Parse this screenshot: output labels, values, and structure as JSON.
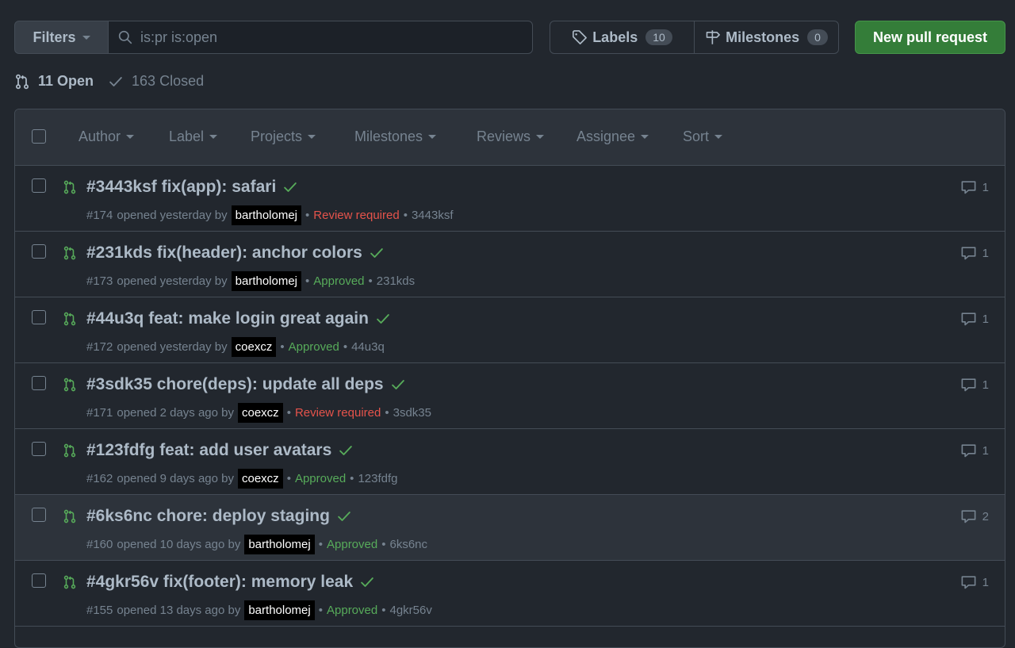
{
  "toolbar": {
    "filters_label": "Filters",
    "search_value": "is:pr is:open",
    "labels_label": "Labels",
    "labels_count": "10",
    "milestones_label": "Milestones",
    "milestones_count": "0",
    "new_pr_label": "New pull request"
  },
  "states": {
    "open_label": "11 Open",
    "closed_label": "163 Closed"
  },
  "header_filters": [
    {
      "label": "Author"
    },
    {
      "label": "Label"
    },
    {
      "label": "Projects"
    },
    {
      "label": "Milestones"
    },
    {
      "label": "Reviews"
    },
    {
      "label": "Assignee"
    },
    {
      "label": "Sort"
    }
  ],
  "pull_requests": [
    {
      "title": "#3443ksf fix(app): safari",
      "number": "#174",
      "opened": "opened yesterday by",
      "author": "bartholomej",
      "review": "Review required",
      "review_state": "required",
      "ref": "3443ksf",
      "comments": "1"
    },
    {
      "title": "#231kds fix(header): anchor colors",
      "number": "#173",
      "opened": "opened yesterday by",
      "author": "bartholomej",
      "review": "Approved",
      "review_state": "approved",
      "ref": "231kds",
      "comments": "1"
    },
    {
      "title": "#44u3q feat: make login great again",
      "number": "#172",
      "opened": "opened yesterday by",
      "author": "coexcz",
      "review": "Approved",
      "review_state": "approved",
      "ref": "44u3q",
      "comments": "1"
    },
    {
      "title": "#3sdk35 chore(deps): update all deps",
      "number": "#171",
      "opened": "opened 2 days ago by",
      "author": "coexcz",
      "review": "Review required",
      "review_state": "required",
      "ref": "3sdk35",
      "comments": "1"
    },
    {
      "title": "#123fdfg feat: add user avatars",
      "number": "#162",
      "opened": "opened 9 days ago by",
      "author": "coexcz",
      "review": "Approved",
      "review_state": "approved",
      "ref": "123fdfg",
      "comments": "1"
    },
    {
      "title": "#6ks6nc chore: deploy staging",
      "number": "#160",
      "opened": "opened 10 days ago by",
      "author": "bartholomej",
      "review": "Approved",
      "review_state": "approved",
      "ref": "6ks6nc",
      "comments": "2"
    },
    {
      "title": "#4gkr56v fix(footer): memory leak",
      "number": "#155",
      "opened": "opened 13 days ago by",
      "author": "bartholomej",
      "review": "Approved",
      "review_state": "approved",
      "ref": "4gkr56v",
      "comments": "1"
    }
  ],
  "colors": {
    "background": "#22272e",
    "accent_green": "#347d39",
    "approved": "#57ab5a",
    "review_required": "#e5534b"
  }
}
